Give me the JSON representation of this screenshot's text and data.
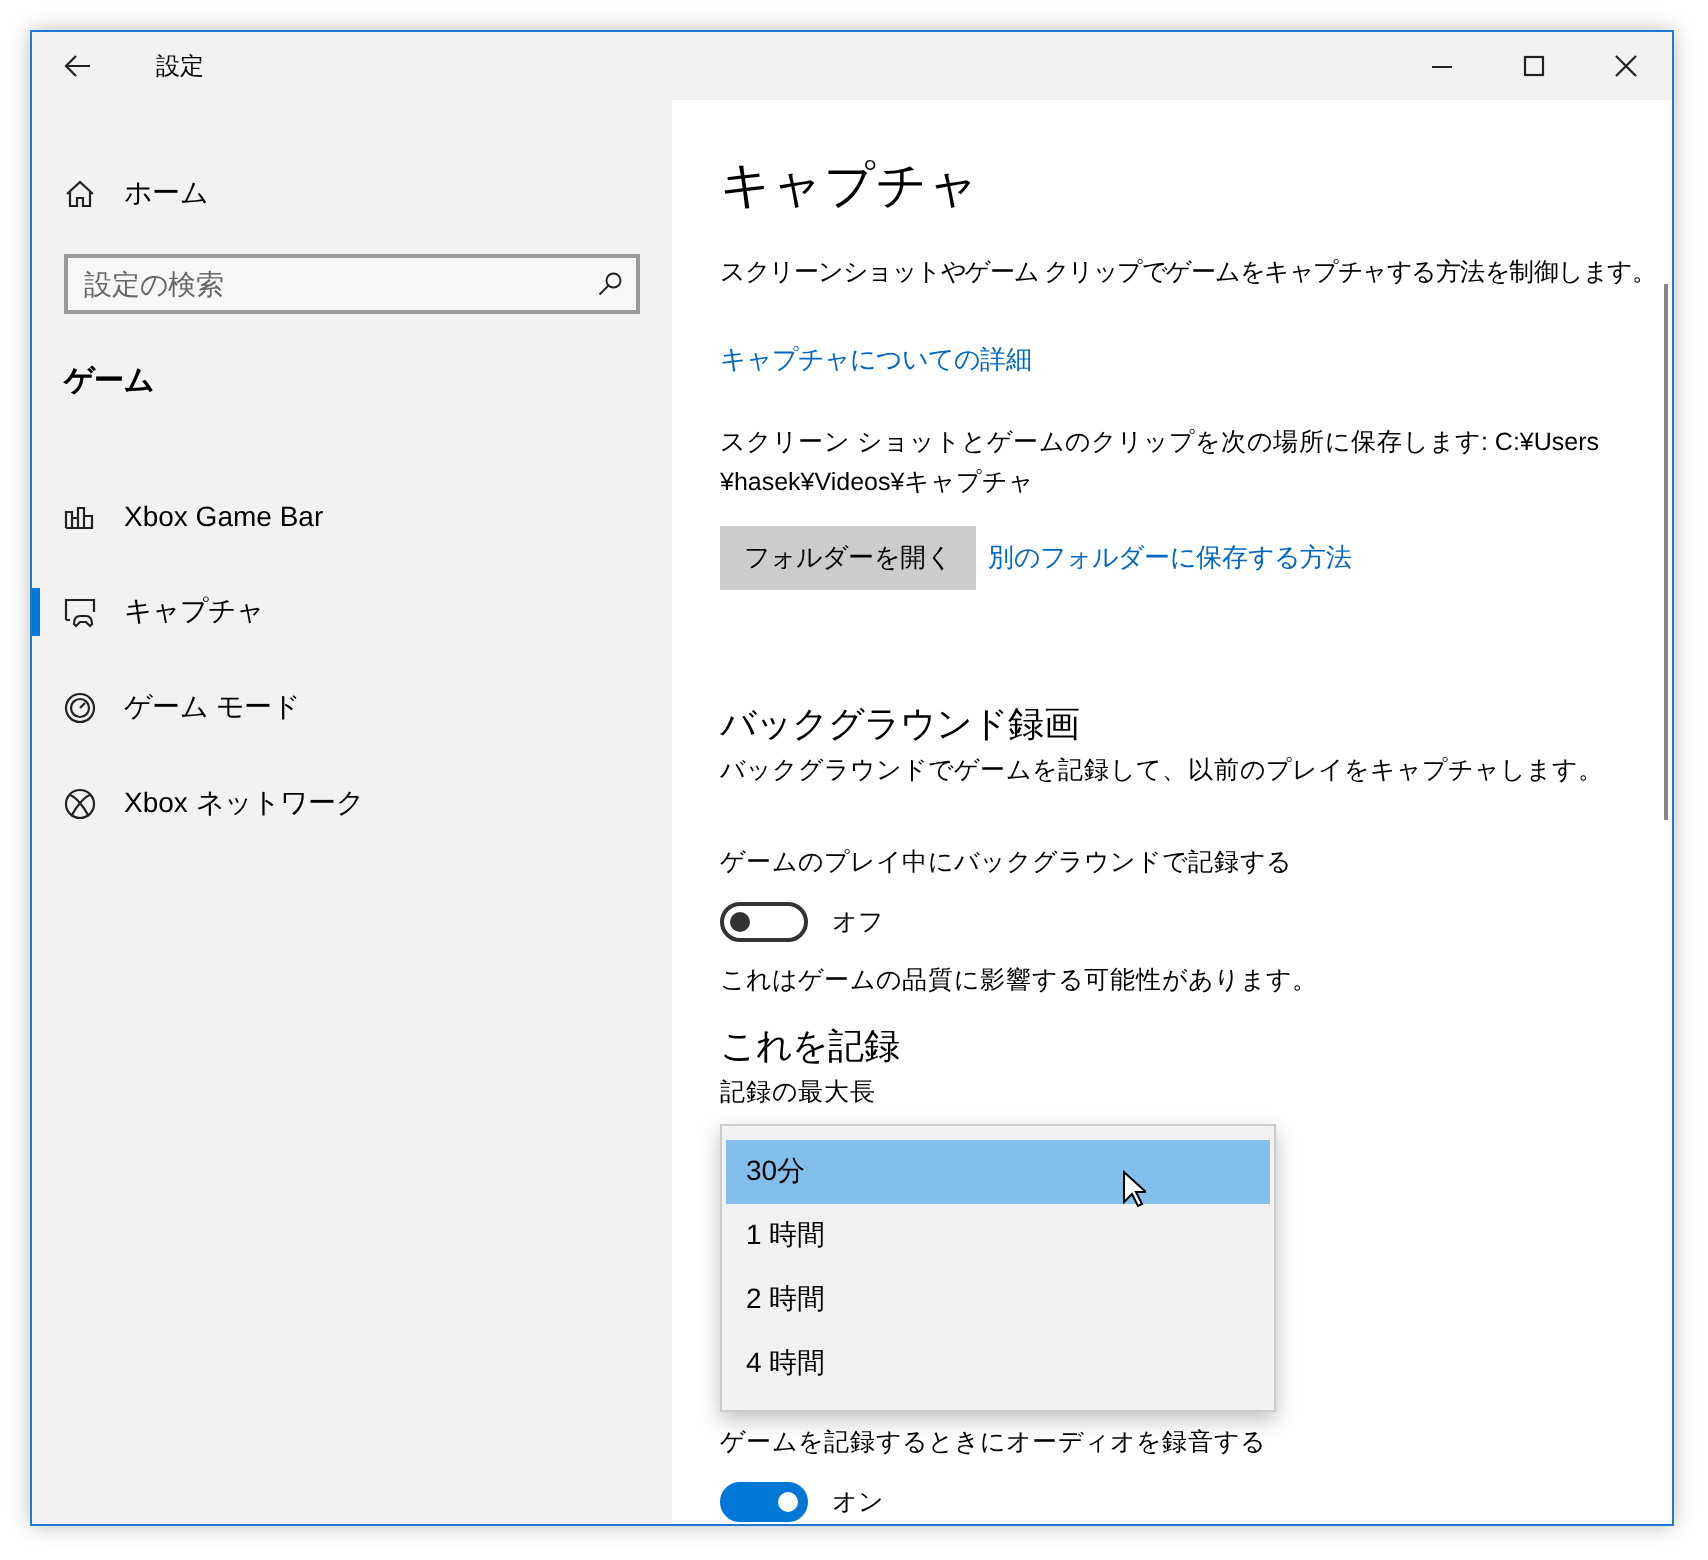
{
  "window": {
    "title": "設定"
  },
  "sidebar": {
    "home": "ホーム",
    "search": {
      "placeholder": "設定の検索"
    },
    "section": "ゲーム",
    "items": [
      {
        "label": "Xbox Game Bar",
        "kind": "gamebar",
        "selected": false
      },
      {
        "label": "キャプチャ",
        "kind": "capture",
        "selected": true
      },
      {
        "label": "ゲーム モード",
        "kind": "gamemode",
        "selected": false
      },
      {
        "label": "Xbox ネットワーク",
        "kind": "xbox",
        "selected": false
      }
    ]
  },
  "content": {
    "title": "キャプチャ",
    "description": "スクリーンショットやゲーム クリップでゲームをキャプチャする方法を制御します。",
    "link": "キャプチャについての詳細",
    "save_location_lines": [
      "スクリーン ショットとゲームのクリップを次の場所に保存します: C:¥Users",
      "¥hasek¥Videos¥キャプチャ"
    ],
    "open_folder_button": "フォルダーを開く",
    "other_folder_link": "別のフォルダーに保存する方法",
    "background": {
      "heading": "バックグラウンド録画",
      "description": "バックグラウンドでゲームを記録して、以前のプレイをキャプチャします。",
      "toggle": {
        "label": "ゲームのプレイ中にバックグラウンドで記録する",
        "on": false,
        "state_text": "オフ"
      },
      "note": "これはゲームの品質に影響する可能性があります。"
    },
    "record": {
      "heading": "これを記録",
      "max_length_label": "記録の最大長"
    },
    "audio": {
      "label": "ゲームを記録するときにオーディオを録音する",
      "on": true,
      "state_text": "オン"
    }
  },
  "dropdown": {
    "options": [
      {
        "label": "30分",
        "selected": true
      },
      {
        "label": "1 時間",
        "selected": false
      },
      {
        "label": "2 時間",
        "selected": false
      },
      {
        "label": "4 時間",
        "selected": false
      }
    ]
  }
}
